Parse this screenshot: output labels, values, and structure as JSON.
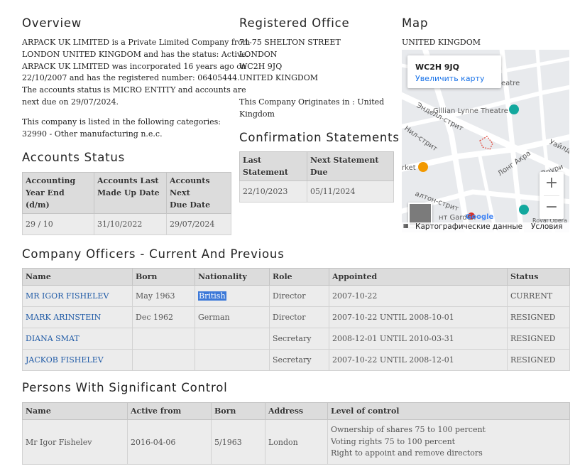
{
  "overview": {
    "title": "Overview",
    "lines": [
      "ARPACK UK LIMITED is a Private Limited Company from",
      "LONDON UNITED KINGDOM and has the status: Active.",
      "ARPACK UK LIMITED was incorporated 16 years ago on",
      "22/10/2007 and has the registered number: 06405444.",
      "The accounts status is MICRO ENTITY and accounts are",
      "next due on 29/07/2024."
    ],
    "category_lines": [
      "This company is listed in the following categories:",
      "32990 - Other manufacturing n.e.c."
    ]
  },
  "registered_office": {
    "title": "Registered Office",
    "address": [
      "71-75 SHELTON STREET",
      "LONDON",
      "WC2H 9JQ",
      "UNITED KINGDOM"
    ],
    "origin_lines": [
      "This Company Originates in : United",
      "Kingdom"
    ]
  },
  "map": {
    "title": "Map",
    "country": "UNITED KINGDOM",
    "popup_title": "WC2H 9JQ",
    "popup_link": "Увеличить карту",
    "place_labels": [
      "Gillian Lynne Theatre",
      "Энделл-стрит",
      "Нил-стрит",
      "Лонг Акра",
      "Друри",
      "Уайлд",
      "rket",
      "нт Garden",
      "Royal Opera H",
      "eatre",
      "алтон-стрит"
    ],
    "google_logo": "Google",
    "attribution": "Картографические данные",
    "terms": "Условия",
    "zoom_in": "+",
    "zoom_out": "−"
  },
  "accounts_status": {
    "title": "Accounts Status",
    "headers": [
      [
        "Accounting",
        "Year End (d/m)"
      ],
      [
        "Accounts Last",
        "Made Up Date"
      ],
      [
        "Accounts Next",
        "Due Date"
      ]
    ],
    "row": [
      "29 / 10",
      "31/10/2022",
      "29/07/2024"
    ]
  },
  "confirmation": {
    "title": "Confirmation Statements",
    "headers": [
      [
        "Last",
        "Statement"
      ],
      [
        "Next Statement",
        "Due"
      ]
    ],
    "row": [
      "22/10/2023",
      "05/11/2024"
    ]
  },
  "officers": {
    "title": "Company Officers - Current And Previous",
    "headers": [
      "Name",
      "Born",
      "Nationality",
      "Role",
      "Appointed",
      "Status"
    ],
    "rows": [
      [
        "MR IGOR FISHELEV",
        "May 1963",
        "British",
        "Director",
        "2007-10-22",
        "CURRENT"
      ],
      [
        "MARK ARINSTEIN",
        "Dec 1962",
        "German",
        "Director",
        "2007-10-22 UNTIL 2008-10-01",
        "RESIGNED"
      ],
      [
        "DIANA SMAT",
        "",
        "",
        "Secretary",
        "2008-12-01 UNTIL 2010-03-31",
        "RESIGNED"
      ],
      [
        "JACKOB FISHELEV",
        "",
        "",
        "Secretary",
        "2007-10-22 UNTIL 2008-12-01",
        "RESIGNED"
      ]
    ]
  },
  "psc": {
    "title": "Persons With Significant Control",
    "headers": [
      "Name",
      "Active from",
      "Born",
      "Address",
      "Level of control"
    ],
    "row": [
      "Mr Igor Fishelev",
      "2016-04-06",
      "5/1963",
      "London"
    ],
    "control": [
      "Ownership of shares 75 to 100 percent",
      "Voting rights 75 to 100 percent",
      "Right to appoint and remove directors"
    ]
  }
}
